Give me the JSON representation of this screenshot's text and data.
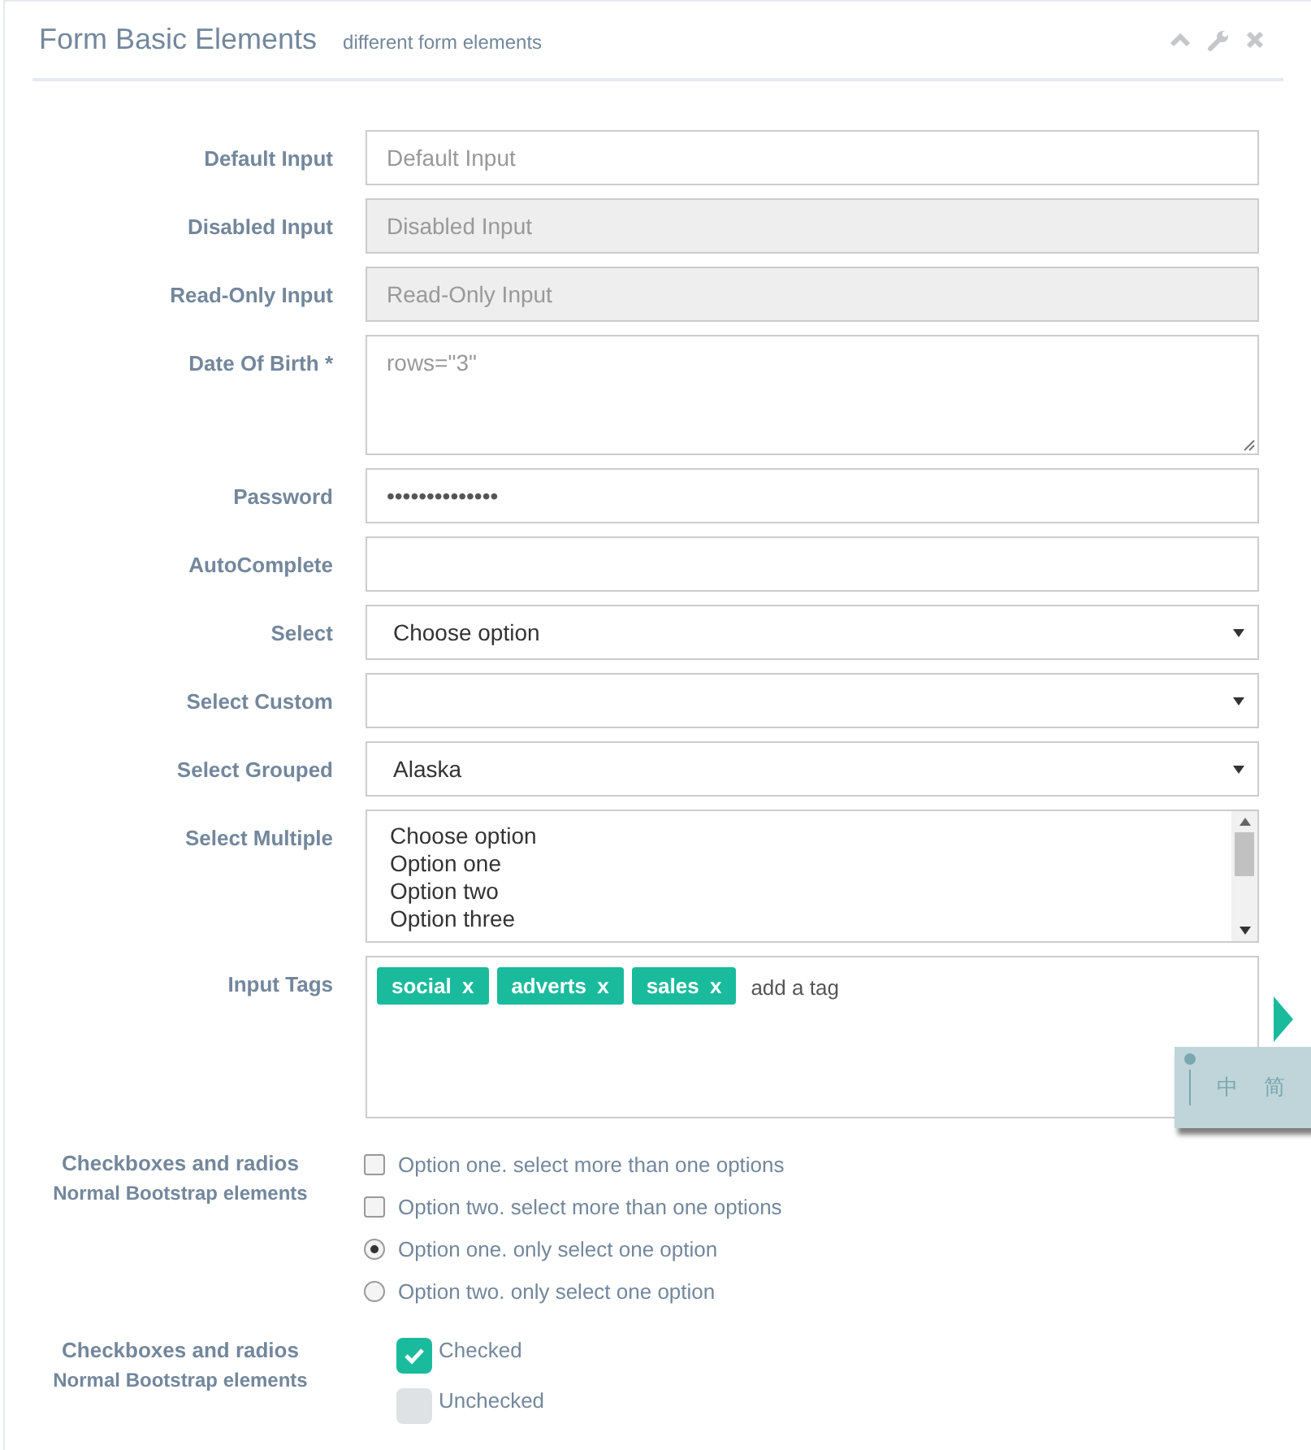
{
  "panel": {
    "title": "Form Basic Elements",
    "subtitle": "different form elements"
  },
  "fields": [
    {
      "kind": "input",
      "label": "Default Input",
      "placeholder": "Default Input",
      "disabled": false
    },
    {
      "kind": "input",
      "label": "Disabled Input",
      "placeholder": "Disabled Input",
      "disabled": true
    },
    {
      "kind": "input",
      "label": "Read-Only Input",
      "placeholder": "Read-Only Input",
      "disabled": true
    },
    {
      "kind": "textarea",
      "label": "Date Of Birth *",
      "placeholder": "rows=\"3\""
    },
    {
      "kind": "input",
      "label": "Password",
      "value": "••••••••••••••",
      "disabled": false
    },
    {
      "kind": "input",
      "label": "AutoComplete",
      "disabled": false
    },
    {
      "kind": "select",
      "label": "Select",
      "value": "Choose option"
    },
    {
      "kind": "select",
      "label": "Select Custom"
    },
    {
      "kind": "select",
      "label": "Select Grouped",
      "value": "Alaska"
    },
    {
      "kind": "multiselect",
      "label": "Select Multiple",
      "options": [
        "Choose option",
        "Option one",
        "Option two",
        "Option three"
      ]
    },
    {
      "kind": "tags",
      "label": "Input Tags",
      "tags": [
        {
          "label": "social",
          "remove": "x"
        },
        {
          "label": "adverts",
          "remove": "x"
        },
        {
          "label": "sales",
          "remove": "x"
        }
      ],
      "placeholder": "add a tag"
    }
  ],
  "check_groups": [
    {
      "label": "Checkboxes and radios",
      "sublabel": "Normal Bootstrap elements",
      "items": [
        {
          "kind": "checkbox",
          "label": "Option one. select more than one options",
          "checked": false
        },
        {
          "kind": "checkbox",
          "label": "Option two. select more than one options",
          "checked": false
        },
        {
          "kind": "radio",
          "label": "Option one. only select one option",
          "checked": true
        },
        {
          "kind": "radio",
          "label": "Option two. only select one option",
          "checked": false
        }
      ]
    },
    {
      "label": "Checkboxes and radios",
      "sublabel": "Normal Bootstrap elements",
      "items": [
        {
          "kind": "flat",
          "label": "Checked",
          "checked": true
        },
        {
          "kind": "flat",
          "label": "Unchecked",
          "checked": false
        }
      ]
    }
  ],
  "ime_toolbar": {
    "buttons": [
      "中",
      "简"
    ]
  }
}
